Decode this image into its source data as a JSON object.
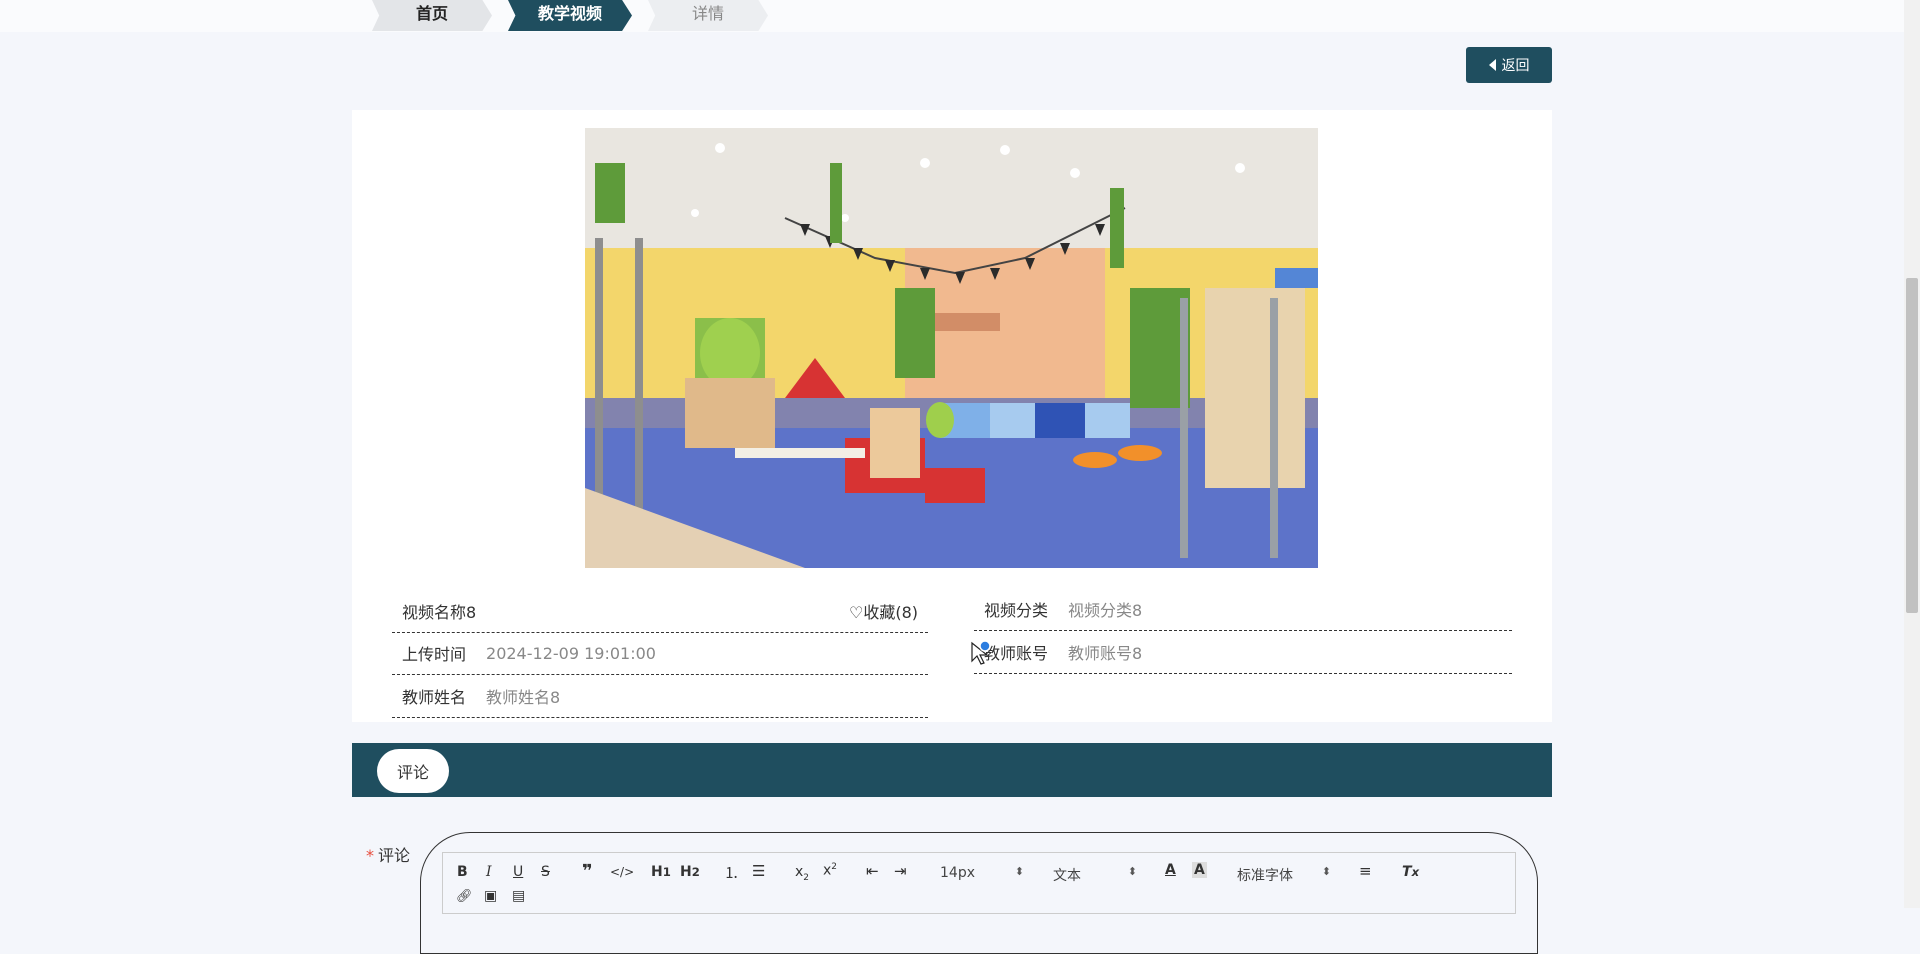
{
  "breadcrumb": {
    "home": "首页",
    "section": "教学视频",
    "current": "详情"
  },
  "back_button": {
    "label": "返回"
  },
  "video": {
    "name": "视频名称8",
    "favorite": "收藏(8)",
    "category_label": "视频分类",
    "category_value": "视频分类8",
    "upload_time_label": "上传时间",
    "upload_time_value": "2024-12-09 19:01:00",
    "teacher_account_label": "教师账号",
    "teacher_account_value": "教师账号8",
    "teacher_name_label": "教师姓名",
    "teacher_name_value": "教师姓名8"
  },
  "comments": {
    "tab_label": "评论",
    "field_label": "评论",
    "required_mark": "*"
  },
  "editor": {
    "font_size": "14px",
    "block_format": "文本",
    "font_family": "标准字体",
    "buttons": [
      "bold-icon",
      "italic-icon",
      "underline-icon",
      "strike-icon",
      "quote-icon",
      "code-icon",
      "h1-icon",
      "h2-icon",
      "ordered-list-icon",
      "bullet-list-icon",
      "subscript-icon",
      "superscript-icon",
      "outdent-icon",
      "indent-icon",
      "font-color-icon",
      "background-color-icon",
      "align-icon",
      "clear-format-icon",
      "link-icon",
      "image-icon",
      "video-icon"
    ]
  },
  "colors": {
    "accent": "#1f4e5f",
    "background": "#f4f6fb",
    "required": "#e74c3c"
  }
}
